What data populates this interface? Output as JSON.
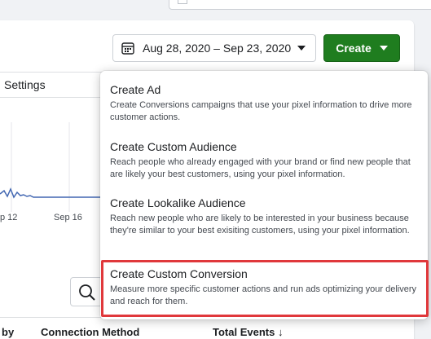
{
  "toolbar": {
    "date_range": "Aug 28, 2020 – Sep 23, 2020",
    "create_label": "Create",
    "accent_color": "#1f7d1f"
  },
  "tabs": {
    "settings": "Settings"
  },
  "chart": {
    "x_ticks": [
      "p 12",
      "Sep 16"
    ]
  },
  "table": {
    "columns": [
      "by",
      "Connection Method",
      "Total Events ↓"
    ]
  },
  "menu": {
    "items": [
      {
        "title": "Create Ad",
        "description": "Create Conversions campaigns that use your pixel information to drive more customer actions."
      },
      {
        "title": "Create Custom Audience",
        "description": "Reach people who already engaged with your brand or find new people that are likely your best customers, using your pixel information."
      },
      {
        "title": "Create Lookalike Audience",
        "description": "Reach new people who are likely to be interested in your business because they're similar to your best exisiting customers, using your pixel information."
      },
      {
        "title": "Create Custom Conversion",
        "description": "Measure more specific customer actions and run ads optimizing your delivery and reach for them."
      }
    ],
    "highlight_color": "#e0383b"
  }
}
